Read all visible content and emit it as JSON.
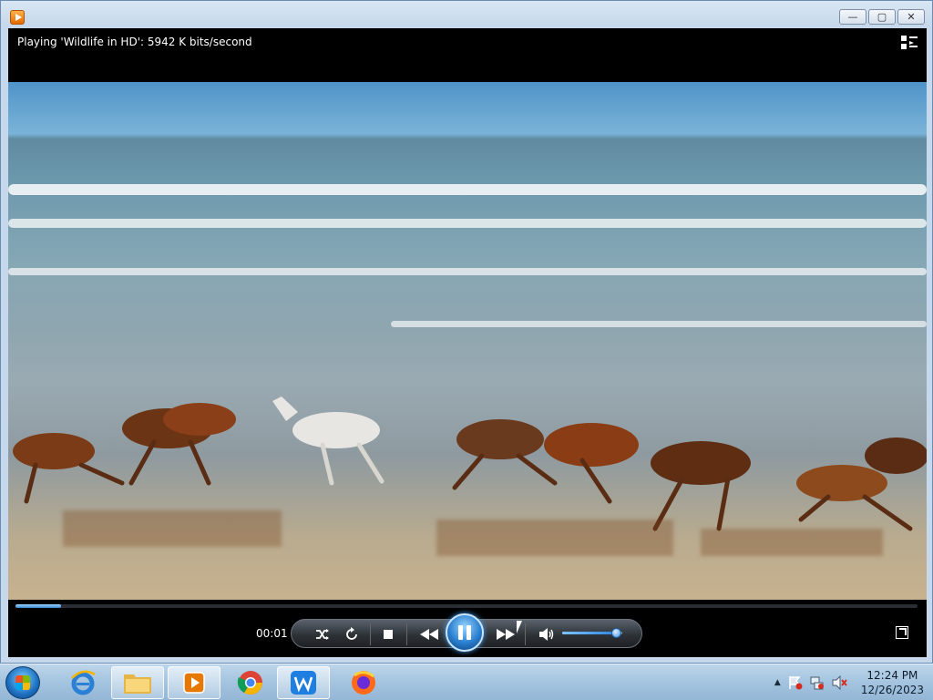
{
  "player": {
    "now_playing": "Playing 'Wildlife in HD': 5942 K bits/second",
    "elapsed_time": "00:01",
    "seek_progress_fraction": 0.05,
    "volume_fraction": 0.9
  },
  "window_controls": {
    "minimize": "—",
    "maximize": "▢",
    "close": "✕"
  },
  "taskbar": {
    "clock_time": "12:24 PM",
    "clock_date": "12/26/2023"
  },
  "colors": {
    "accent": "#2a7fcf",
    "player_bg": "#000000"
  }
}
